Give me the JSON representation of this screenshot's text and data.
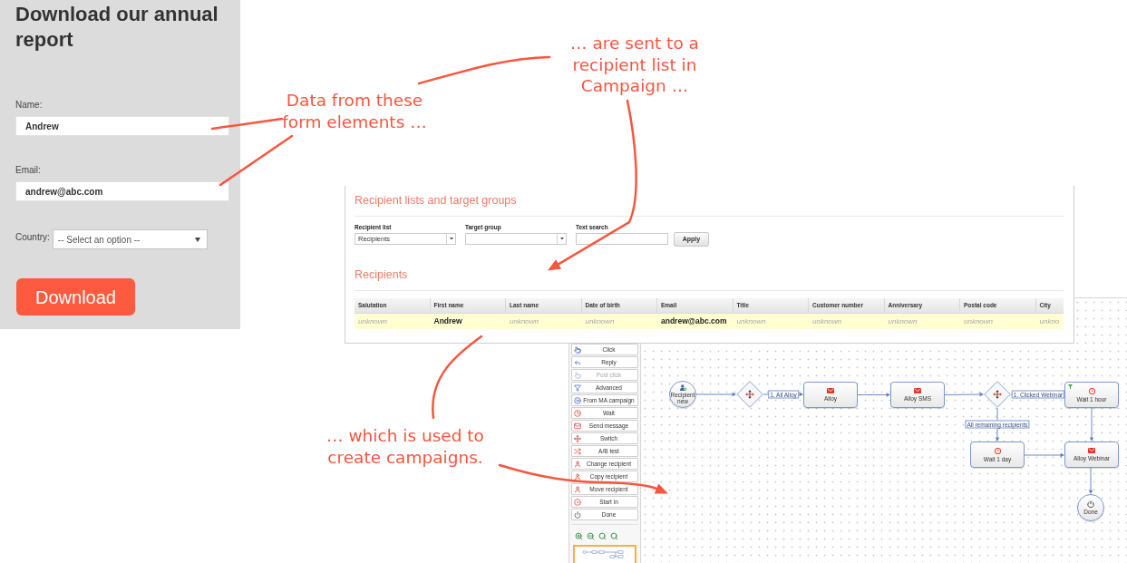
{
  "form": {
    "title": "Download our annual report",
    "fields": [
      {
        "kind": "text",
        "label": "Name:",
        "value": "Andrew"
      },
      {
        "kind": "text",
        "label": "Email:",
        "value": "andrew@abc.com"
      },
      {
        "kind": "select",
        "label": "Country:",
        "value": "-- Select an option --"
      }
    ],
    "button": "Download"
  },
  "annotations": [
    {
      "lines": [
        "Data from these",
        "form elements …"
      ]
    },
    {
      "lines": [
        "… are sent to a",
        "recipient list in",
        "Campaign …"
      ]
    },
    {
      "lines": [
        "… which is used to",
        "create campaigns."
      ]
    }
  ],
  "recipients_panel": {
    "title": "Recipient lists and target groups",
    "filters": [
      {
        "kind": "select",
        "label": "Recipient list",
        "value": "Recipients"
      },
      {
        "kind": "select",
        "label": "Target group"
      },
      {
        "kind": "input",
        "label": "Text search"
      }
    ],
    "apply_button": "Apply",
    "section_title": "Recipients",
    "table": {
      "columns": [
        "Salutation",
        "First name",
        "Last name",
        "Date of birth",
        "Email",
        "Title",
        "Customer number",
        "Anniversary",
        "Postal code",
        "City"
      ],
      "rows": [
        {
          "selected": true,
          "cells": [
            {
              "text": "unknown",
              "missing": true
            },
            {
              "text": "Andrew",
              "missing": false
            },
            {
              "text": "unknown",
              "missing": true
            },
            {
              "text": "unknown",
              "missing": true
            },
            {
              "text": "andrew@abc.com",
              "missing": false
            },
            {
              "text": "unknown",
              "missing": true
            },
            {
              "text": "unknown",
              "missing": true
            },
            {
              "text": "unknown",
              "missing": true
            },
            {
              "text": "unknown",
              "missing": true
            },
            {
              "text": "unkno",
              "missing": true
            }
          ]
        }
      ]
    }
  },
  "workflow": {
    "palette": [
      {
        "label": "Click",
        "disabled": false
      },
      {
        "label": "Reply",
        "disabled": false
      },
      {
        "label": "Post click",
        "disabled": true
      },
      {
        "label": "Advanced",
        "disabled": false
      },
      {
        "label": "From MA campaign",
        "disabled": false
      },
      {
        "label": "Wait",
        "disabled": false
      },
      {
        "label": "Send message",
        "disabled": false
      },
      {
        "label": "Switch",
        "disabled": false
      },
      {
        "label": "A/B test",
        "disabled": false
      },
      {
        "label": "Change recipient",
        "disabled": false
      },
      {
        "label": "Copy recipient",
        "disabled": false
      },
      {
        "label": "Move recipient",
        "disabled": false
      },
      {
        "label": "Start in",
        "disabled": false
      },
      {
        "label": "Done",
        "disabled": false
      }
    ],
    "nodes": [
      {
        "kind": "start",
        "label": "Recipient new",
        "filtered": false
      },
      {
        "kind": "switch",
        "filtered": false
      },
      {
        "kind": "message",
        "label": "Alloy",
        "filtered": false
      },
      {
        "kind": "message",
        "label": "Alloy SMS",
        "filtered": false
      },
      {
        "kind": "switch",
        "filtered": false
      },
      {
        "kind": "wait",
        "label": "Wait 1 hour",
        "filtered": true
      },
      {
        "kind": "wait",
        "label": "Wait 1 day",
        "filtered": false
      },
      {
        "kind": "message",
        "label": "Alloy Webinar",
        "filtered": false
      },
      {
        "kind": "end",
        "label": "Done",
        "filtered": false
      }
    ],
    "edge_labels": [
      "1. All Alloy",
      "1. Clicked Webinar",
      "All remaining recipients"
    ]
  }
}
